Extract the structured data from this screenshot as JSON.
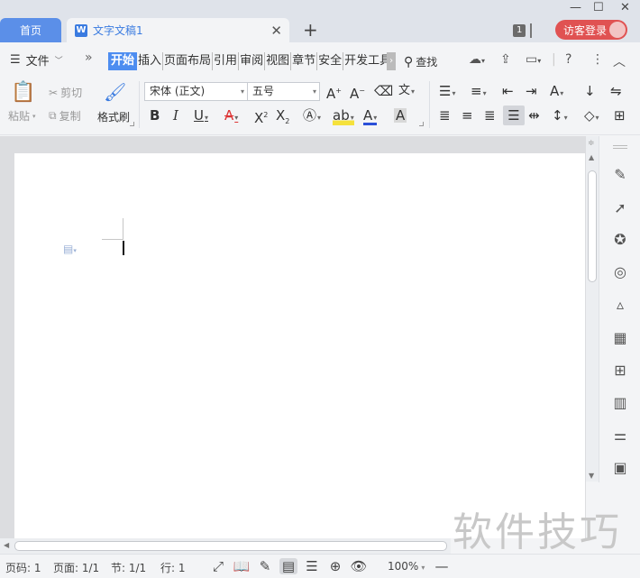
{
  "tabs": {
    "home": "首页",
    "document": "文字文稿1",
    "doc_icon": "W"
  },
  "window": {
    "badge": "1",
    "login": "访客登录"
  },
  "menu": {
    "file": "文件",
    "ribbon_tabs": [
      "开始",
      "插入",
      "页面布局",
      "引用",
      "审阅",
      "视图",
      "章节",
      "安全",
      "开发工具"
    ],
    "find": "查找"
  },
  "ribbon": {
    "paste": "粘贴",
    "cut": "剪切",
    "copy": "复制",
    "format_painter": "格式刷",
    "font_name": "宋体 (正文)",
    "font_size": "五号"
  },
  "status": {
    "page_no": "页码: 1",
    "pages": "页面: 1/1",
    "section": "节: 1/1",
    "line": "行: 1",
    "zoom": "100%"
  },
  "watermark": "软件技巧",
  "colors": {
    "accent": "#4d8df0",
    "home_tab": "#5b8fe8",
    "login": "#e05252"
  }
}
